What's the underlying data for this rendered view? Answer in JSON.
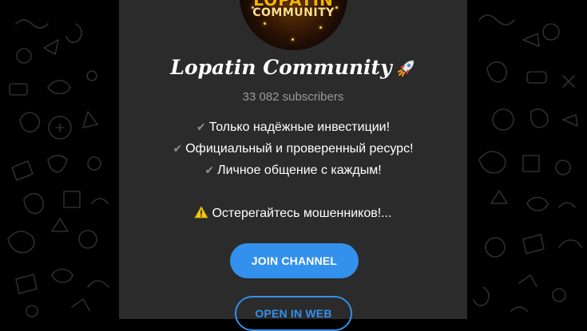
{
  "channel": {
    "logo_text_top": "LOPATIN",
    "logo_text_bottom": "COMMUNITY",
    "name": "Lopatin Community",
    "name_icon": "rocket-icon",
    "subscribers": "33 082 subscribers",
    "description": [
      "Только надёжные инвестиции!",
      "Официальный и проверенный ресурс!",
      "Личное общение с каждым!"
    ],
    "check_icon": "✔",
    "warning": "Остерегайтесь мошенников!..."
  },
  "actions": {
    "join_label": "JOIN CHANNEL",
    "web_label": "OPEN IN WEB"
  },
  "colors": {
    "accent": "#3390ec",
    "card": "#2b2b2b",
    "background": "#000000"
  }
}
